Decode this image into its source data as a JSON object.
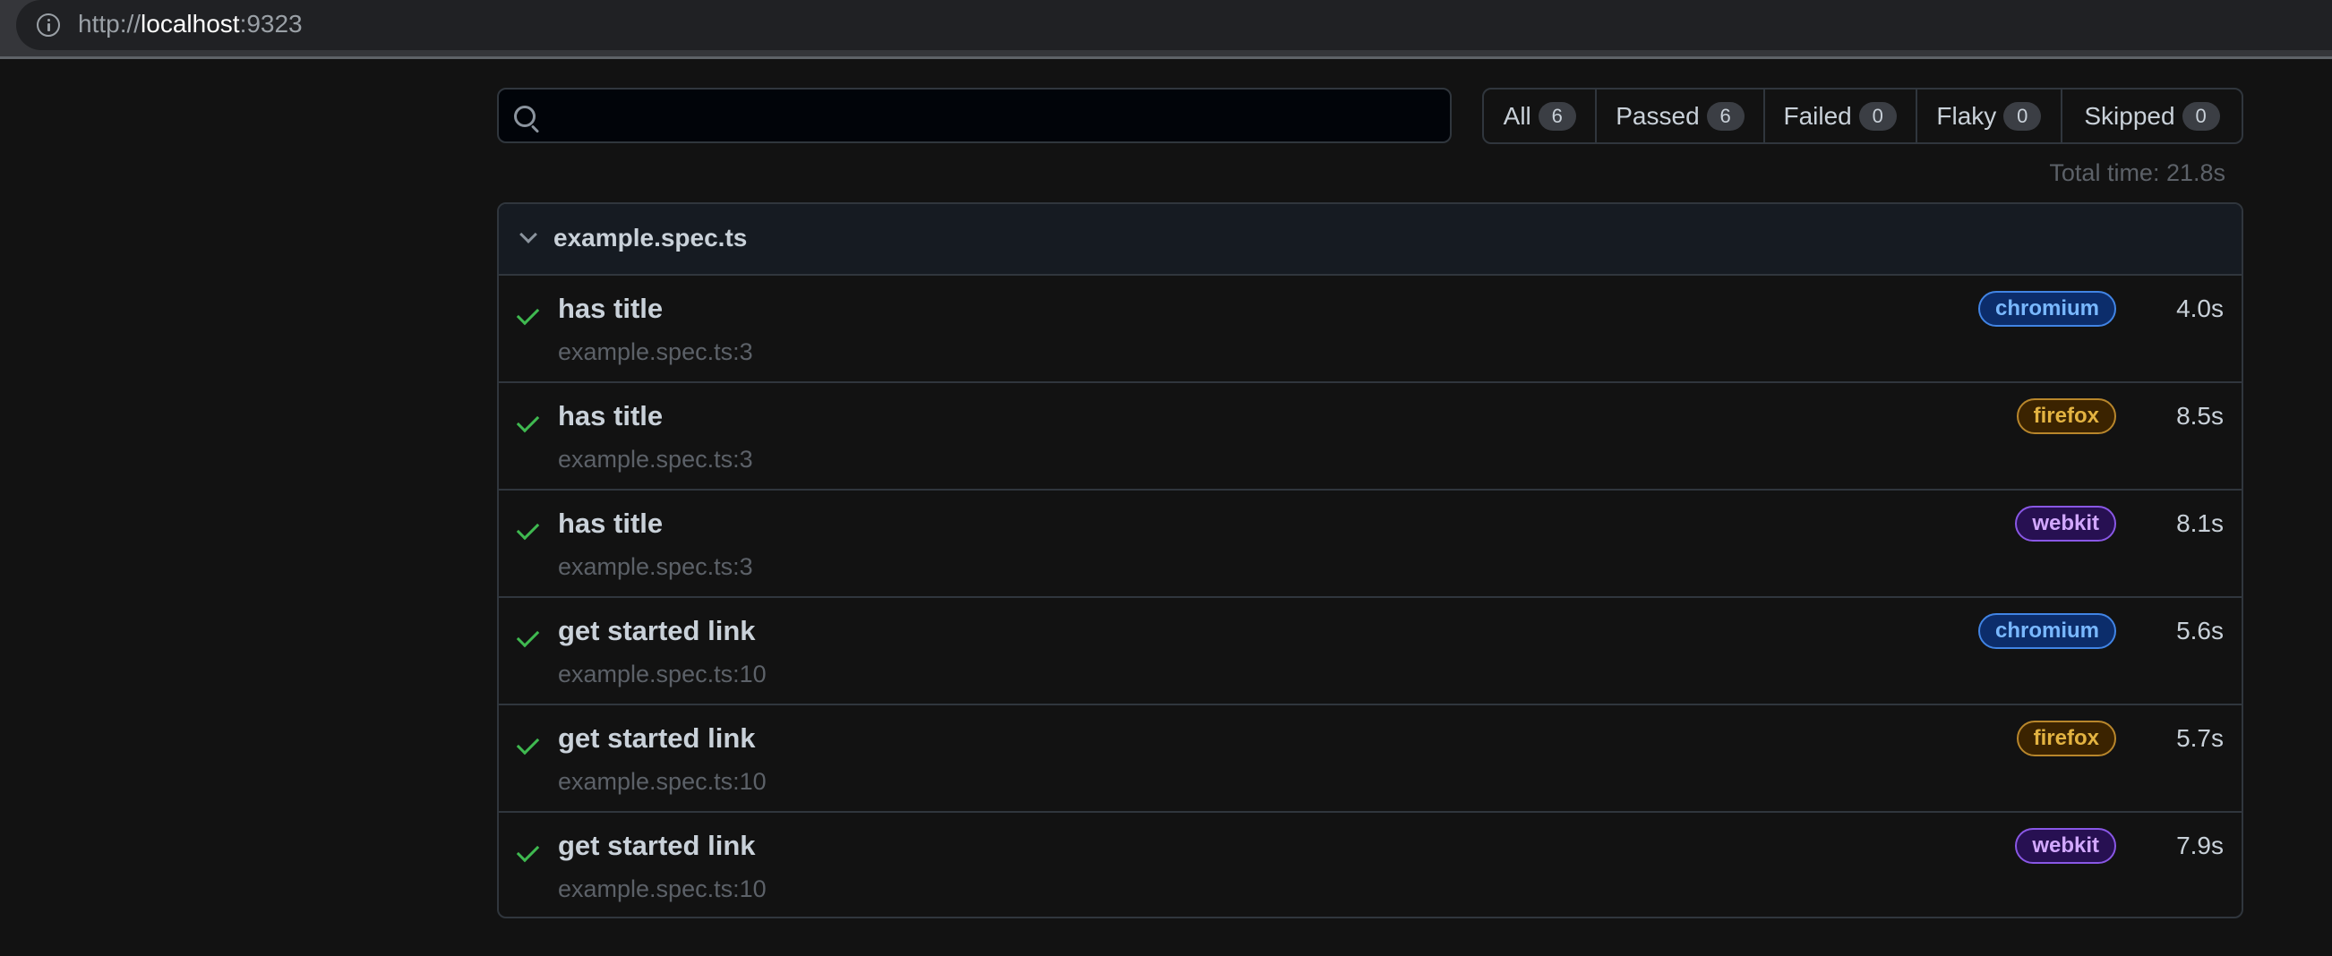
{
  "browser": {
    "url_scheme": "http://",
    "url_host": "localhost",
    "url_port": ":9323",
    "info_icon": "info-icon"
  },
  "search": {
    "placeholder": "",
    "value": "",
    "icon": "search-icon"
  },
  "filters": [
    {
      "label": "All",
      "count": "6"
    },
    {
      "label": "Passed",
      "count": "6"
    },
    {
      "label": "Failed",
      "count": "0"
    },
    {
      "label": "Flaky",
      "count": "0"
    },
    {
      "label": "Skipped",
      "count": "0"
    }
  ],
  "total_time": "Total time: 21.8s",
  "file": {
    "name": "example.spec.ts",
    "expanded": true,
    "tests": [
      {
        "title": "has title",
        "location": "example.spec.ts:3",
        "project": "chromium",
        "duration": "4.0s",
        "status": "passed"
      },
      {
        "title": "has title",
        "location": "example.spec.ts:3",
        "project": "firefox",
        "duration": "8.5s",
        "status": "passed"
      },
      {
        "title": "has title",
        "location": "example.spec.ts:3",
        "project": "webkit",
        "duration": "8.1s",
        "status": "passed"
      },
      {
        "title": "get started link",
        "location": "example.spec.ts:10",
        "project": "chromium",
        "duration": "5.6s",
        "status": "passed"
      },
      {
        "title": "get started link",
        "location": "example.spec.ts:10",
        "project": "firefox",
        "duration": "5.7s",
        "status": "passed"
      },
      {
        "title": "get started link",
        "location": "example.spec.ts:10",
        "project": "webkit",
        "duration": "7.9s",
        "status": "passed"
      }
    ]
  },
  "colors": {
    "passed": "#3fb950",
    "chromium": "#79b8ff",
    "firefox": "#e3b341",
    "webkit": "#d2a8ff"
  }
}
